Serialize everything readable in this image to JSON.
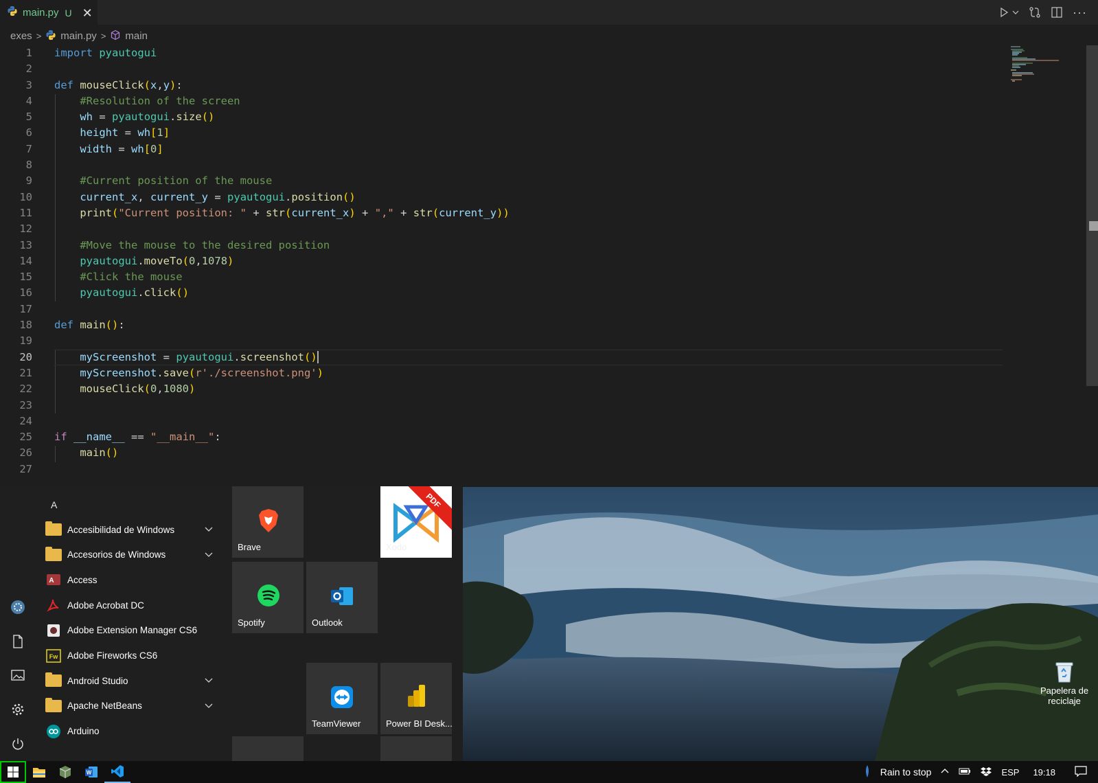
{
  "tab": {
    "filename": "main.py",
    "status": "U"
  },
  "breadcrumb": {
    "folder": "exes",
    "file": "main.py",
    "symbol": "main"
  },
  "editor": {
    "active_line": 20,
    "line_numbers": [
      "1",
      "2",
      "3",
      "4",
      "5",
      "6",
      "7",
      "8",
      "9",
      "10",
      "11",
      "12",
      "13",
      "14",
      "15",
      "16",
      "17",
      "18",
      "19",
      "20",
      "21",
      "22",
      "23",
      "24",
      "25",
      "26",
      "27"
    ],
    "code_lines": [
      "import pyautogui",
      "",
      "def mouseClick(x,y):",
      "    #Resolution of the screen",
      "    wh = pyautogui.size()",
      "    height = wh[1]",
      "    width = wh[0]",
      "",
      "    #Current position of the mouse",
      "    current_x, current_y = pyautogui.position()",
      "    print(\"Current position: \" + str(current_x) + \",\" + str(current_y))",
      "",
      "    #Move the mouse to the desired position",
      "    pyautogui.moveTo(0,1078)",
      "    #Click the mouse",
      "    pyautogui.click()",
      "",
      "def main():",
      "",
      "    myScreenshot = pyautogui.screenshot()",
      "    mySc reenshot.save(r'./screenshot.png')",
      "    mouseClick(0,1080)",
      "",
      "",
      "if __name__ == \"__main__\":",
      "    main()",
      ""
    ]
  },
  "start_menu": {
    "letter": "A",
    "apps": [
      {
        "label": "Accesibilidad de Windows",
        "icon": "folder-icon",
        "expandable": true
      },
      {
        "label": "Accesorios de Windows",
        "icon": "folder-icon",
        "expandable": true
      },
      {
        "label": "Access",
        "icon": "access-icon",
        "expandable": false
      },
      {
        "label": "Adobe Acrobat DC",
        "icon": "acrobat-icon",
        "expandable": false
      },
      {
        "label": "Adobe Extension Manager CS6",
        "icon": "extension-manager-icon",
        "expandable": false
      },
      {
        "label": "Adobe Fireworks CS6",
        "icon": "fireworks-icon",
        "expandable": false
      },
      {
        "label": "Android Studio",
        "icon": "folder-icon",
        "expandable": true
      },
      {
        "label": "Apache NetBeans",
        "icon": "folder-icon",
        "expandable": true
      },
      {
        "label": "Arduino",
        "icon": "arduino-icon",
        "expandable": false
      }
    ],
    "tiles": {
      "brave": "Brave",
      "xodo": "Xodo",
      "xodo_badge": "PDF",
      "spotify": "Spotify",
      "outlook": "Outlook",
      "teamviewer": "TeamViewer",
      "powerbi": "Power BI Desk..."
    }
  },
  "desktop": {
    "recycle_bin": "Papelera de reciclaje"
  },
  "taskbar": {
    "weather": "Rain to stop",
    "language": "ESP",
    "time": "19:18"
  },
  "colors": {
    "editor_bg": "#1e1e1e",
    "start_bg": "#1f1f1f",
    "taskbar_bg": "#101010",
    "start_button_accent": "#00c800"
  }
}
